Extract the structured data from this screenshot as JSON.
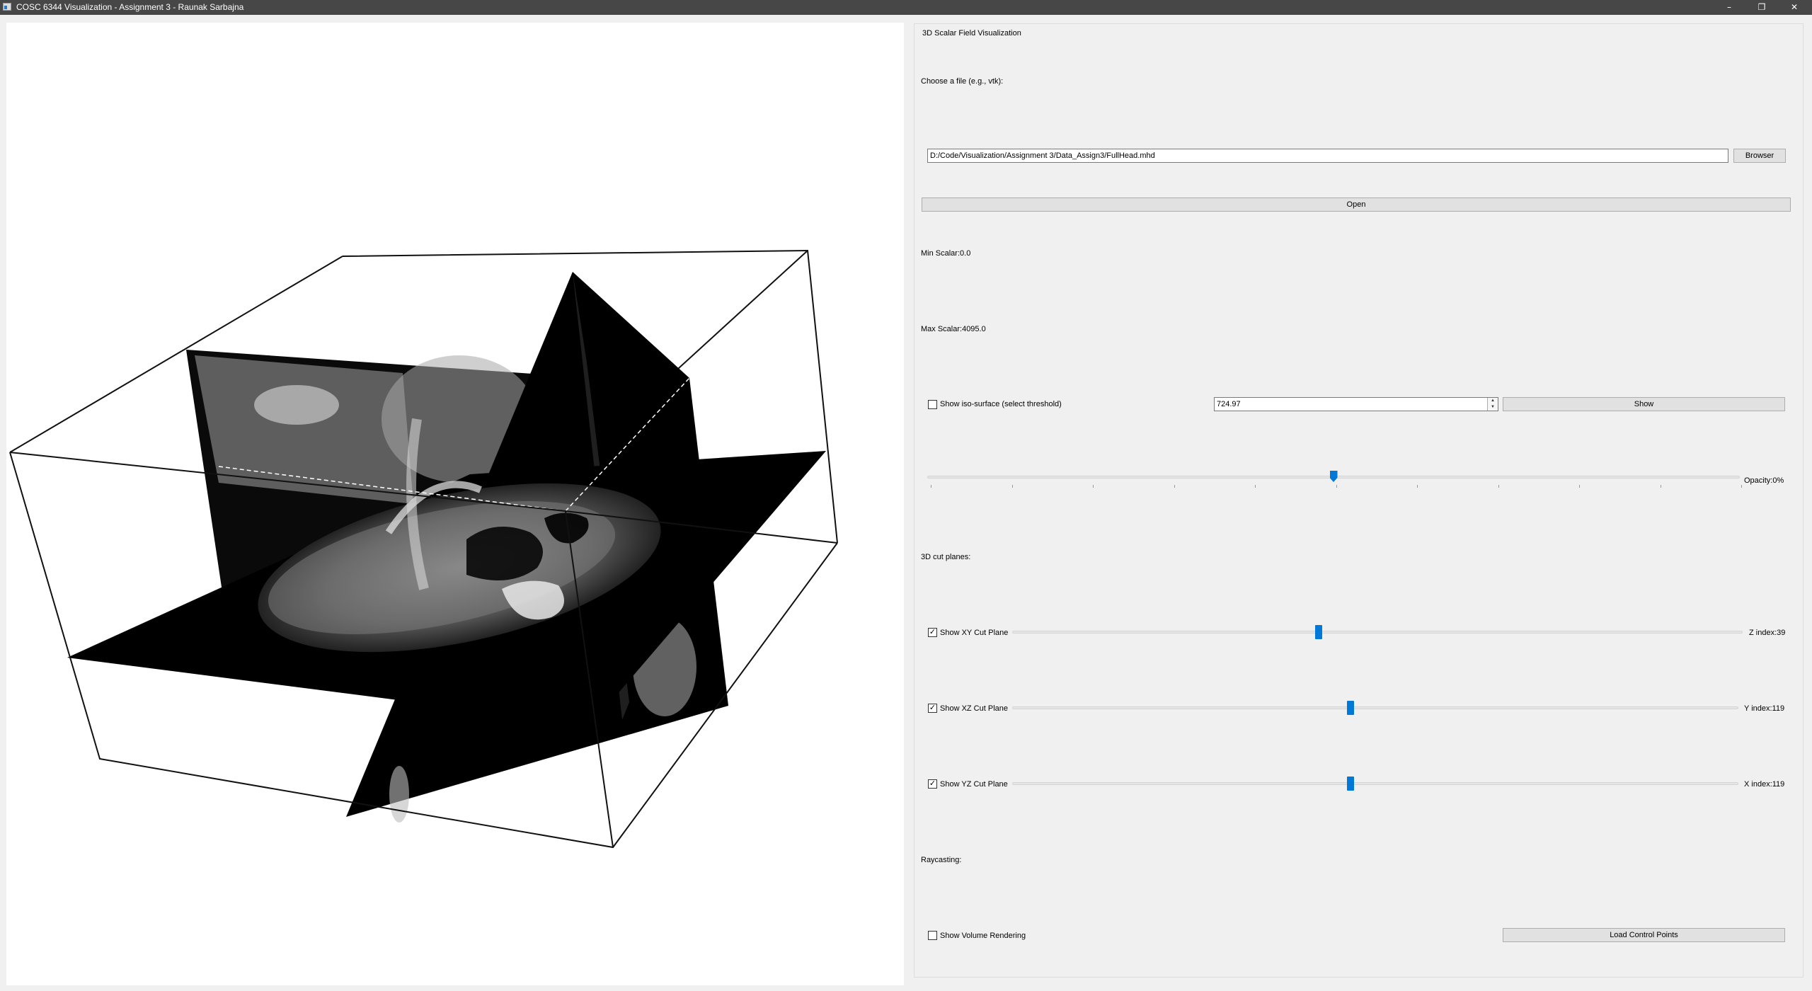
{
  "window": {
    "title": "COSC 6344 Visualization - Assignment 3 - Raunak Sarbajna",
    "minimize": "–",
    "maximize": "❐",
    "close": "✕"
  },
  "panel": {
    "group_title": "3D Scalar Field Visualization",
    "choose_file_label": "Choose a file (e.g., vtk):",
    "file_path": "D:/Code/Visualization/Assignment 3/Data_Assign3/FullHead.mhd",
    "browser_button": "Browser",
    "open_button": "Open",
    "min_scalar": "Min Scalar:0.0",
    "max_scalar": "Max Scalar:4095.0",
    "iso_checkbox_label": "Show iso-surface (select threshold)",
    "iso_checked": false,
    "iso_value": "724.97",
    "show_button": "Show",
    "opacity_label": "Opacity:0%",
    "opacity_slider_fraction": 0.5,
    "cut_planes_label": "3D cut planes:",
    "xy_label": "Show XY Cut Plane",
    "xy_checked": true,
    "xy_index": "Z index:39",
    "xy_fraction": 0.42,
    "xz_label": "Show XZ Cut Plane",
    "xz_checked": true,
    "xz_index": "Y index:119",
    "xz_fraction": 0.466,
    "yz_label": "Show YZ Cut Plane",
    "yz_checked": true,
    "yz_index": "X index:119",
    "yz_fraction": 0.466,
    "raycasting_label": "Raycasting:",
    "volume_checkbox_label": "Show Volume Rendering",
    "volume_checked": false,
    "load_control_points_button": "Load Control Points"
  },
  "icons": {
    "app": "window-app-icon",
    "minimize": "minimize-icon",
    "maximize": "restore-icon",
    "close": "close-icon"
  }
}
